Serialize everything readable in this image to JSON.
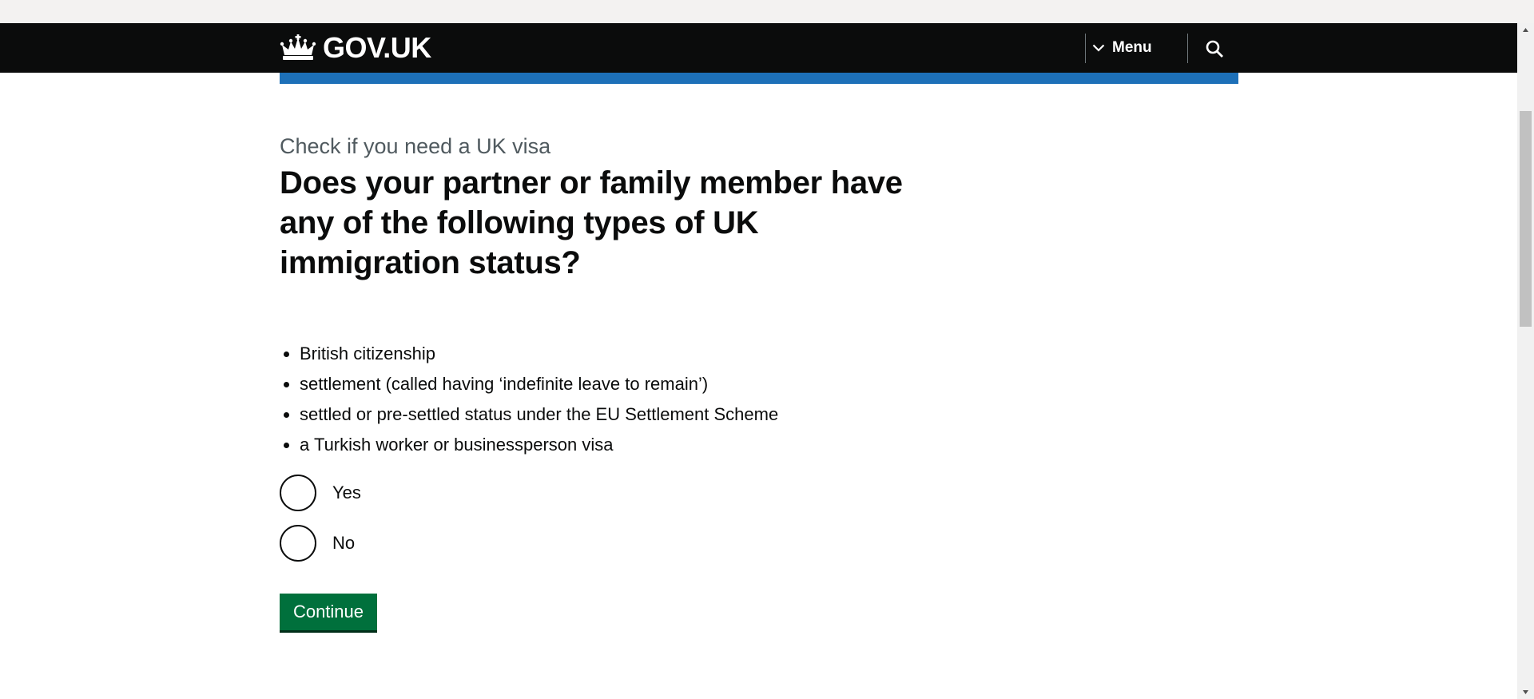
{
  "header": {
    "logo_text": "GOV.UK",
    "menu_label": "Menu"
  },
  "page": {
    "caption": "Check if you need a UK visa",
    "heading": "Does your partner or family member have any of the following types of UK immigration status?",
    "bullets": [
      "British citizenship",
      "settlement (called having ‘indefinite leave to remain’)",
      "settled or pre-settled status under the EU Settlement Scheme",
      "a Turkish worker or businessperson visa"
    ],
    "options": [
      "Yes",
      "No"
    ],
    "continue_label": "Continue"
  },
  "colors": {
    "header_bg": "#0b0c0c",
    "accent_blue": "#1d70b8",
    "button_green": "#00703c"
  }
}
